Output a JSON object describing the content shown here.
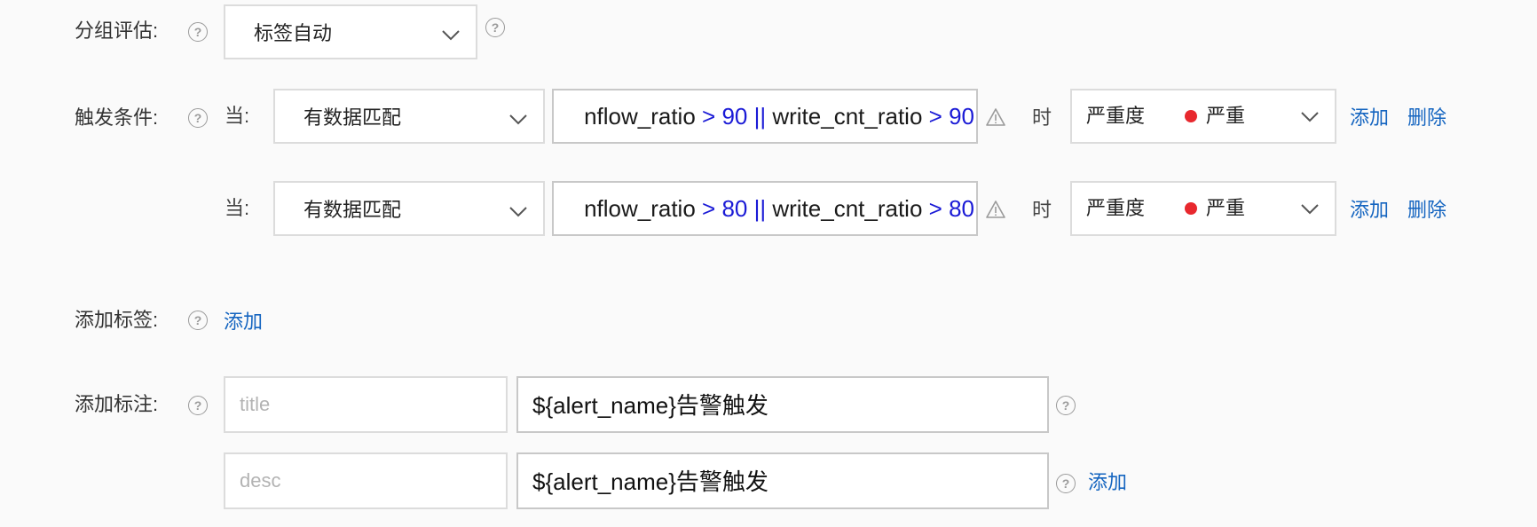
{
  "group_eval": {
    "label": "分组评估:",
    "selected": "标签自动"
  },
  "trigger": {
    "label": "触发条件:",
    "rows": [
      {
        "when_label": "当:",
        "match_mode": "有数据匹配",
        "expr_part1": "nflow_ratio ",
        "expr_op1": ">",
        "expr_val1": " 90",
        "expr_or": " || ",
        "expr_part2": "write_cnt_ratio ",
        "expr_op2": ">",
        "expr_val2": " 90",
        "time_label": "时",
        "severity_label": "严重度",
        "severity_value": "严重",
        "add_label": "添加",
        "delete_label": "删除"
      },
      {
        "when_label": "当:",
        "match_mode": "有数据匹配",
        "expr_part1": "nflow_ratio ",
        "expr_op1": ">",
        "expr_val1": " 80",
        "expr_or": " || ",
        "expr_part2": "write_cnt_ratio ",
        "expr_op2": ">",
        "expr_val2": " 80",
        "time_label": "时",
        "severity_label": "严重度",
        "severity_value": "严重",
        "add_label": "添加",
        "delete_label": "删除"
      }
    ]
  },
  "add_tags": {
    "label": "添加标签:",
    "add_link": "添加"
  },
  "add_annotations": {
    "label": "添加标注:",
    "rows": [
      {
        "key_placeholder": "title",
        "value": "${alert_name}告警触发"
      },
      {
        "key_placeholder": "desc",
        "value": "${alert_name}告警触发"
      }
    ],
    "add_link": "添加"
  },
  "icons": {
    "help": "question-circle-icon",
    "dropdown": "chevron-down-icon",
    "warning": "warning-triangle-icon"
  },
  "colors": {
    "link": "#1565c0",
    "severity_critical": "#e8282e",
    "operator": "#1a1ad6"
  }
}
